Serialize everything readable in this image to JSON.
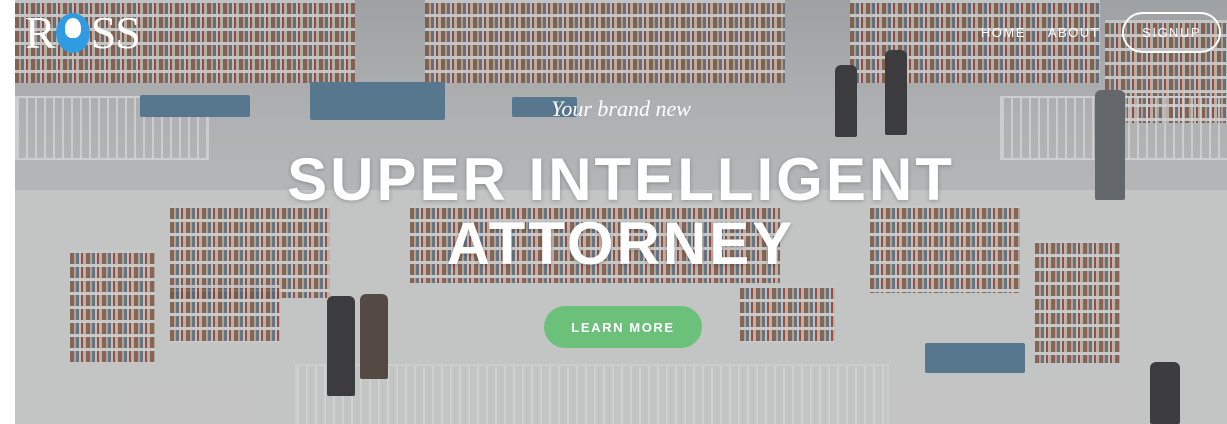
{
  "brand": {
    "name": "ROSS",
    "logo_left": "R",
    "logo_right": "SS"
  },
  "nav": {
    "home": "HOME",
    "about": "ABOUT",
    "signup": "SIGNUP"
  },
  "hero": {
    "tagline": "Your brand new",
    "headline_line1": "SUPER INTELLIGENT",
    "headline_line2": "ATTORNEY",
    "cta_label": "LEARN MORE"
  },
  "colors": {
    "cta": "#6cc17a",
    "logo_accent": "#2f9be0"
  },
  "icons": [
    "logo-head-icon"
  ]
}
